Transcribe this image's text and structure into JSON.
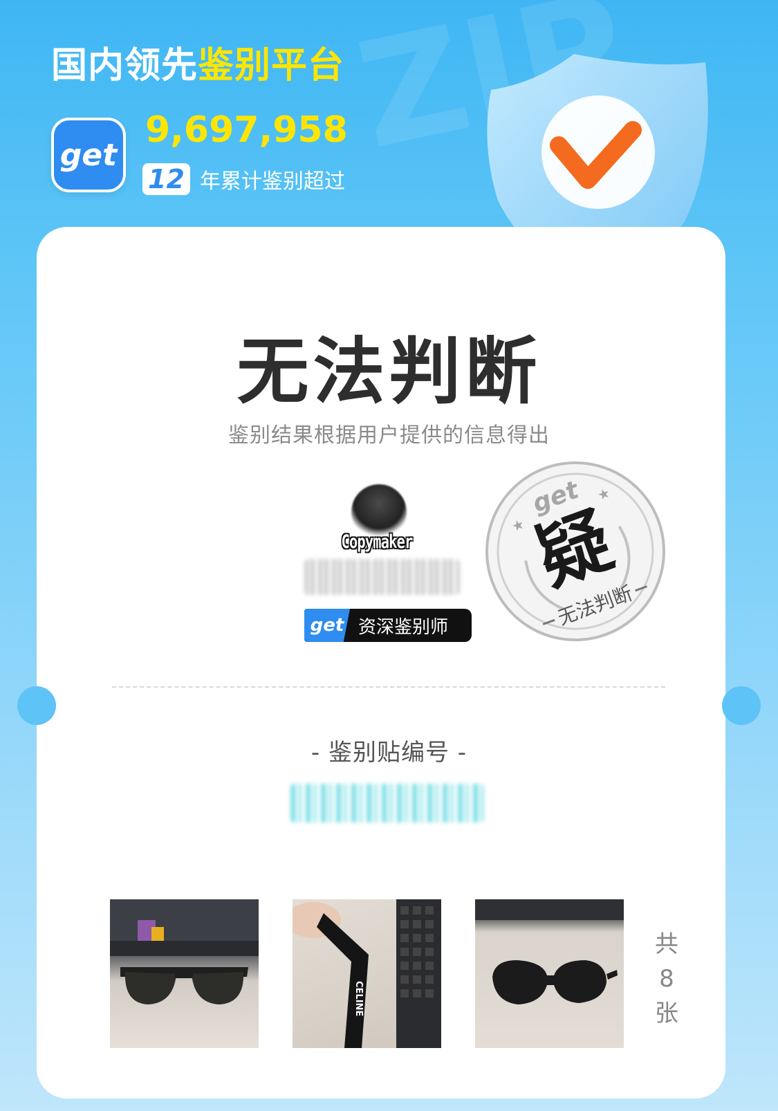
{
  "header": {
    "headline_white": "国内领先",
    "headline_yellow": "鉴别平台",
    "logo_text": "get",
    "total_count": "9,697,958",
    "years": "12",
    "years_text": "年累计鉴别超过"
  },
  "result": {
    "verdict": "无法判断",
    "note": "鉴别结果根据用户提供的信息得出"
  },
  "appraiser": {
    "name": "Copymaker",
    "badge_logo": "get",
    "badge_title": "资深鉴别师"
  },
  "stamp": {
    "brand": "get",
    "char": "疑",
    "text": "无法判断"
  },
  "code": {
    "label": "- 鉴别贴编号 -"
  },
  "photos": {
    "items": [
      {
        "desc": "sunglasses-front"
      },
      {
        "desc": "temple-logo"
      },
      {
        "desc": "sunglasses-angle"
      }
    ],
    "count_chars": [
      "共",
      "8",
      "张"
    ],
    "temple_brand": "CELINE"
  },
  "colors": {
    "brand_blue": "#2f8cf0",
    "accent_yellow": "#ffe600",
    "check_orange": "#f46a1e"
  }
}
